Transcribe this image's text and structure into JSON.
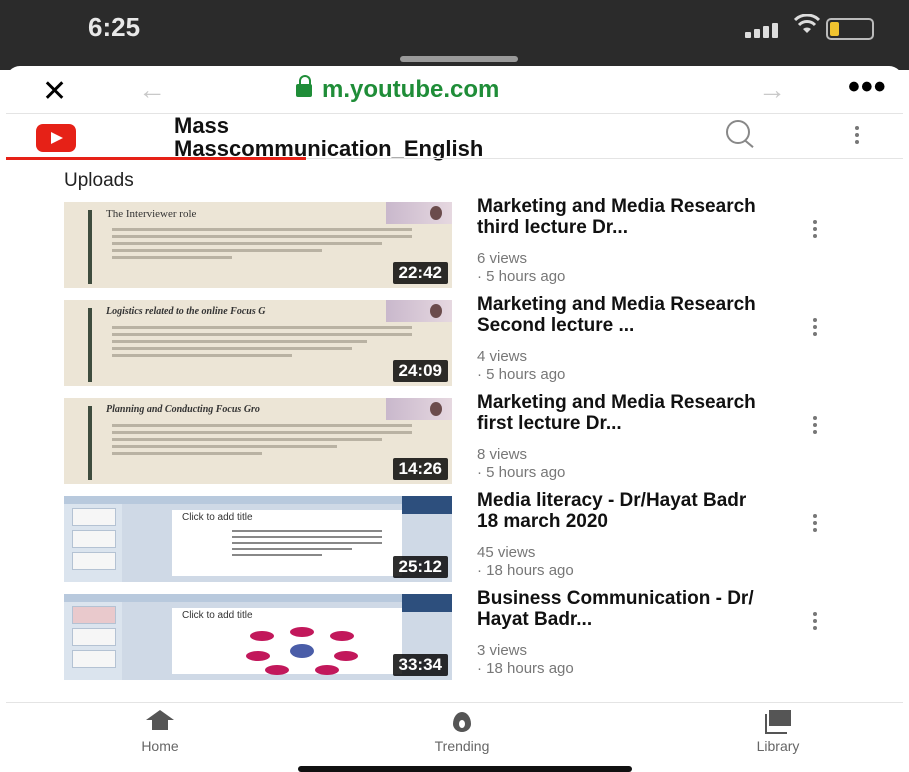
{
  "status": {
    "time": "6:25"
  },
  "browser": {
    "url": "m.youtube.com"
  },
  "channel": {
    "name_line1": "Mass",
    "name_line2": "Masscommunication_English",
    "section": "Uploads"
  },
  "colors": {
    "accent": "#e62117",
    "url_green": "#1f8d38"
  },
  "videos": [
    {
      "title": "Marketing and Media Research third lecture Dr...",
      "views": "6 views",
      "age": "· 5 hours ago",
      "duration": "22:42",
      "thumb_text": "The Interviewer role"
    },
    {
      "title": "Marketing and Media Research Second lecture ...",
      "views": "4 views",
      "age": "· 5 hours ago",
      "duration": "24:09",
      "thumb_text": "Logistics related to the online Focus G"
    },
    {
      "title": "Marketing and Media Research first lecture Dr...",
      "views": "8 views",
      "age": "· 5 hours ago",
      "duration": "14:26",
      "thumb_text": "Planning and Conducting Focus Gro"
    },
    {
      "title": "Media literacy - Dr/Hayat Badr 18 march 2020",
      "views": "45 views",
      "age": "· 18 hours ago",
      "duration": "25:12",
      "thumb_text": "Click to add title"
    },
    {
      "title": "Business Communication - Dr/ Hayat Badr...",
      "views": "3 views",
      "age": "· 18 hours ago",
      "duration": "33:34",
      "thumb_text": "Click to add title"
    }
  ],
  "nav": {
    "home": "Home",
    "trending": "Trending",
    "library": "Library"
  },
  "icons": [
    "close-icon",
    "back-arrow-icon",
    "forward-arrow-icon",
    "more-icon",
    "lock-icon",
    "youtube-logo-icon",
    "search-icon",
    "kebab-icon",
    "home-icon",
    "trending-icon",
    "library-icon"
  ]
}
